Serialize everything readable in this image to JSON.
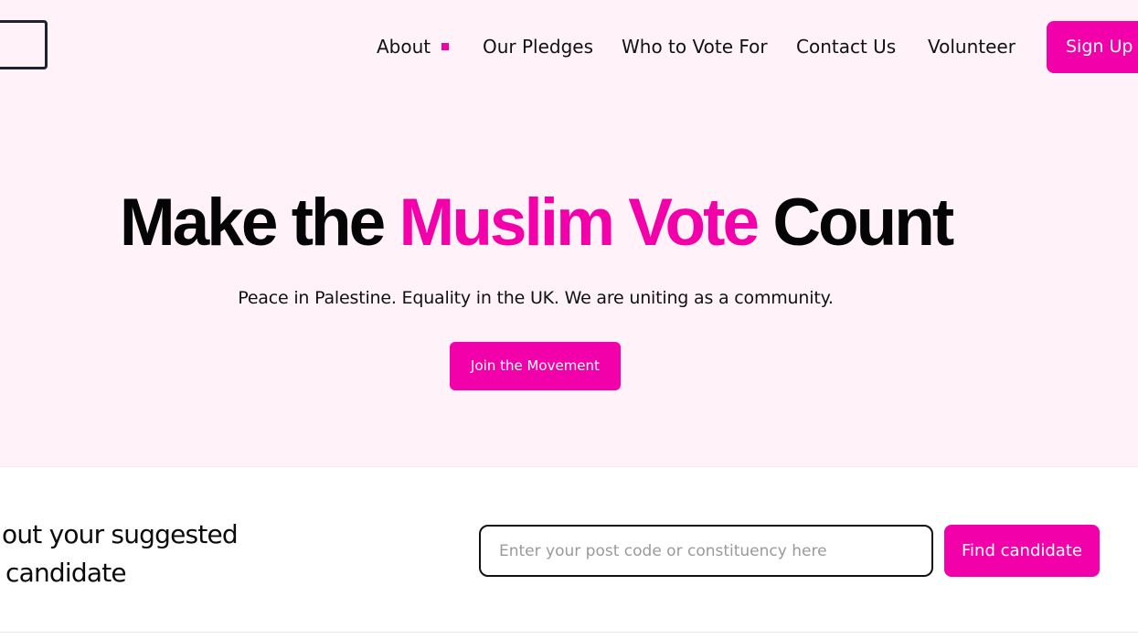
{
  "header": {
    "nav": [
      {
        "label": "About"
      },
      {
        "label": "Our Pledges"
      },
      {
        "label": "Who to Vote For"
      },
      {
        "label": "Contact Us"
      },
      {
        "label": "Volunteer"
      }
    ],
    "signup_label": "Sign Up"
  },
  "hero": {
    "title_part1": "Make the ",
    "title_accent": "Muslim Vote",
    "title_part2": " Count",
    "subtitle": "Peace in Palestine. Equality in the UK. We are uniting as a community.",
    "cta_label": "Join the Movement"
  },
  "finder": {
    "heading_line1": "nd out your suggested",
    "heading_line2": "cal candidate",
    "input_value": "",
    "input_placeholder": "Enter your post code or constituency here",
    "button_label": "Find candidate"
  },
  "colors": {
    "accent": "#f200a9",
    "hero_background": "#fff3f9",
    "text": "#0d0d0d"
  }
}
